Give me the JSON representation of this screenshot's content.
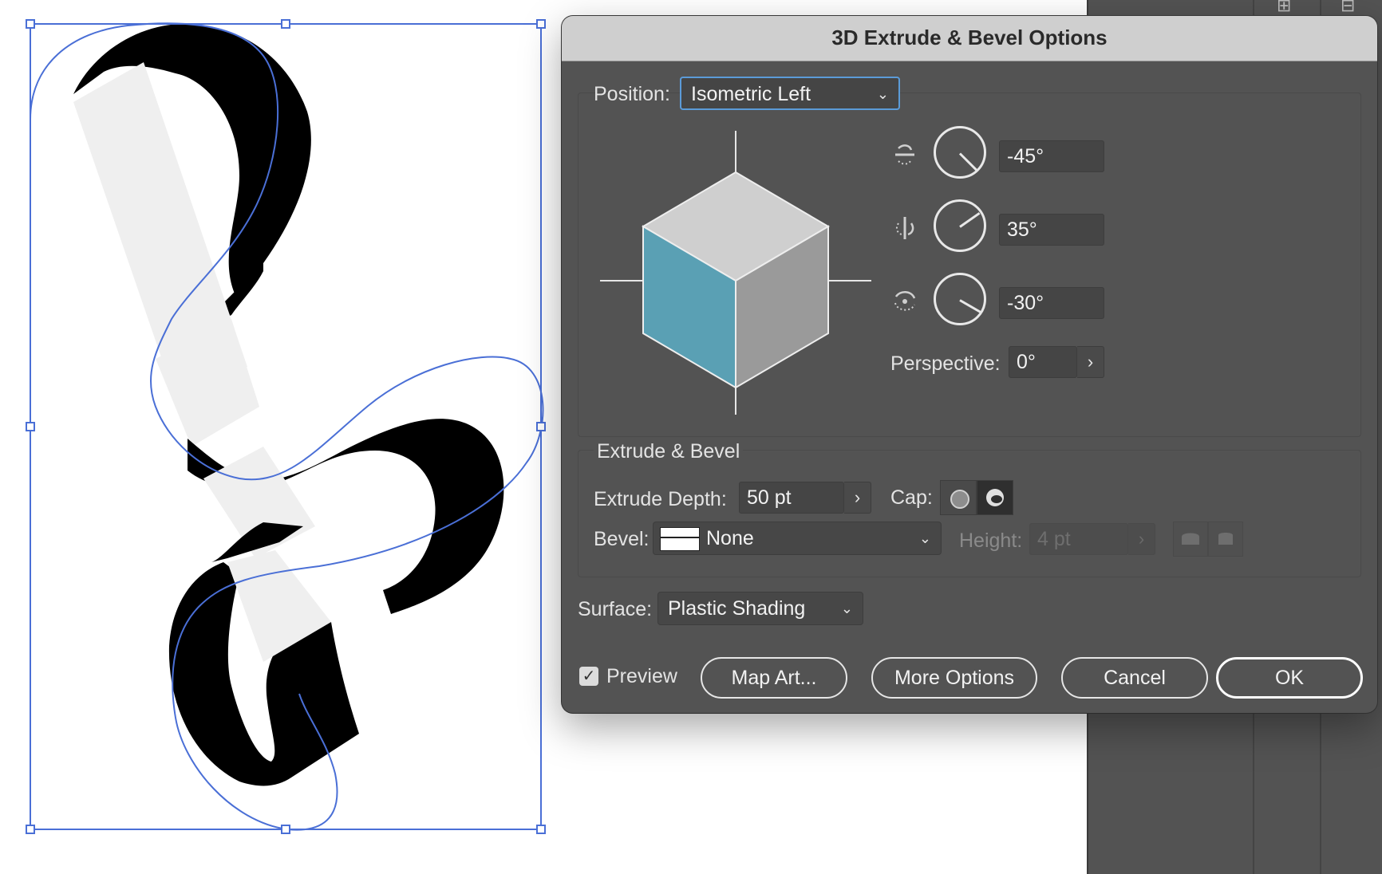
{
  "dialog": {
    "title": "3D Extrude & Bevel Options",
    "position": {
      "label": "Position:",
      "value": "Isometric Left"
    },
    "rotation": {
      "x_angle": "-45°",
      "y_angle": "35°",
      "z_angle": "-30°"
    },
    "perspective": {
      "label": "Perspective:",
      "value": "0°"
    },
    "extrude_bevel": {
      "section_label": "Extrude & Bevel",
      "depth_label": "Extrude Depth:",
      "depth_value": "50 pt",
      "cap_label": "Cap:",
      "bevel_label": "Bevel:",
      "bevel_value": "None",
      "height_label": "Height:",
      "height_value": "4 pt"
    },
    "surface": {
      "label": "Surface:",
      "value": "Plastic Shading"
    },
    "preview_label": "Preview",
    "buttons": {
      "map_art": "Map Art...",
      "more_options": "More Options",
      "cancel": "Cancel",
      "ok": "OK"
    }
  },
  "colors": {
    "dialog_bg": "#535353",
    "cube_left_face": "#5aa0b4",
    "cube_top_face": "#cfcfcf",
    "cube_right_face": "#9a9a9a",
    "selection": "#4a6fd6",
    "focus_ring": "#5b9bd8"
  },
  "icons": {
    "x_axis": "rotate-x-axis-icon",
    "y_axis": "rotate-y-axis-icon",
    "z_axis": "rotate-z-axis-icon",
    "cap_on": "cap-on-icon",
    "cap_off": "cap-off-icon",
    "bevel_in": "bevel-in-icon",
    "bevel_out": "bevel-out-icon"
  }
}
